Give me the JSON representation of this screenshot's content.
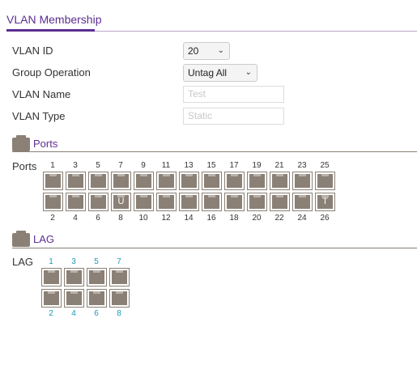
{
  "header": {
    "title": "VLAN Membership"
  },
  "form": {
    "vlan_id": {
      "label": "VLAN ID",
      "value": "20"
    },
    "group_operation": {
      "label": "Group Operation",
      "value": "Untag All"
    },
    "vlan_name": {
      "label": "VLAN Name",
      "placeholder": "Test"
    },
    "vlan_type": {
      "label": "VLAN Type",
      "placeholder": "Static"
    }
  },
  "ports_section": {
    "title": "Ports",
    "row_label": "Ports",
    "top_numbers": [
      "1",
      "3",
      "5",
      "7",
      "9",
      "11",
      "13",
      "15",
      "17",
      "19",
      "21",
      "23",
      "25"
    ],
    "bottom_numbers": [
      "2",
      "4",
      "6",
      "8",
      "10",
      "12",
      "14",
      "16",
      "18",
      "20",
      "22",
      "24",
      "26"
    ],
    "top_marks": [
      "",
      "",
      "",
      "",
      "",
      "",
      "",
      "",
      "",
      "",
      "",
      "",
      ""
    ],
    "bottom_marks": [
      "",
      "",
      "",
      "U",
      "",
      "",
      "",
      "",
      "",
      "",
      "",
      "",
      "T"
    ]
  },
  "lag_section": {
    "title": "LAG",
    "row_label": "LAG",
    "top_numbers": [
      "1",
      "3",
      "5",
      "7"
    ],
    "bottom_numbers": [
      "2",
      "4",
      "6",
      "8"
    ],
    "top_marks": [
      "",
      "",
      "",
      ""
    ],
    "bottom_marks": [
      "",
      "",
      "",
      ""
    ]
  },
  "colors": {
    "accent": "#5c2d91",
    "port": "#8a8076",
    "lag_number": "#1a9bb8"
  },
  "icons": {
    "section": "port-icon",
    "dropdown": "chevron-down-icon"
  }
}
